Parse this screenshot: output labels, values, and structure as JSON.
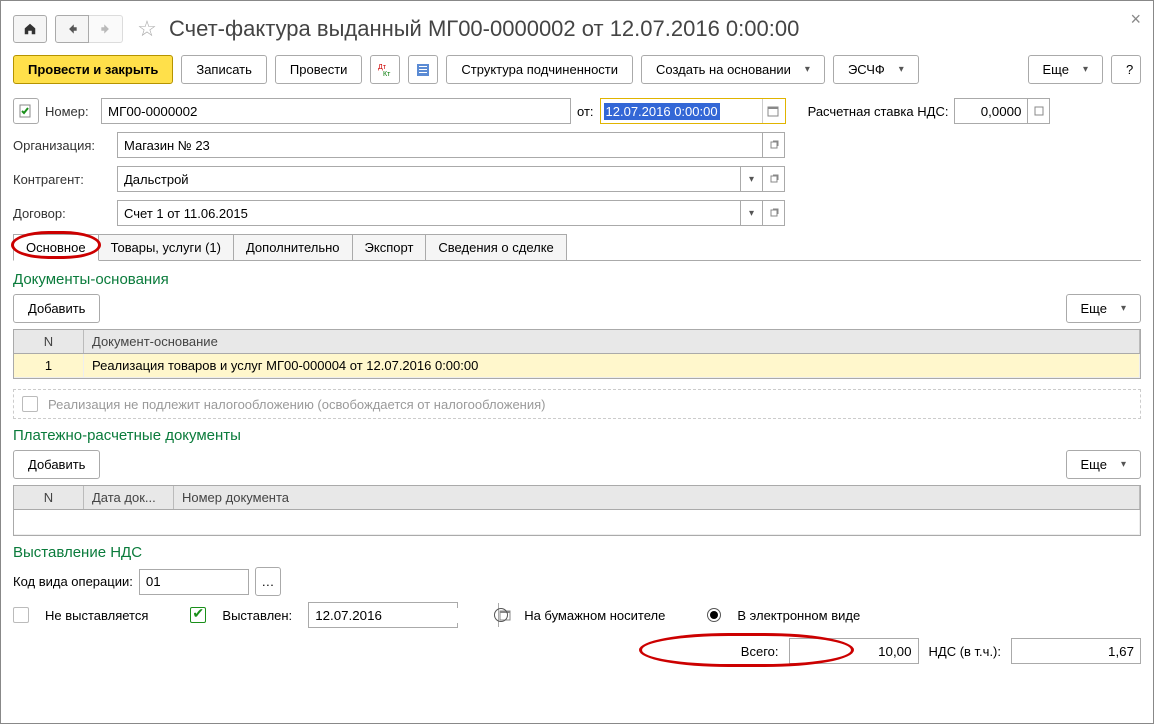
{
  "title": "Счет-фактура выданный МГ00-0000002 от 12.07.2016 0:00:00",
  "toolbar": {
    "post_close": "Провести и закрыть",
    "record": "Записать",
    "post": "Провести",
    "structure": "Структура подчиненности",
    "create_from": "Создать на основании",
    "eschf": "ЭСЧФ",
    "more": "Еще",
    "help": "?"
  },
  "form": {
    "number_label": "Номер:",
    "number_value": "МГ00-0000002",
    "date_label": "от:",
    "date_value": "12.07.2016 0:00:00",
    "rate_label": "Расчетная ставка НДС:",
    "rate_value": "0,0000",
    "org_label": "Организация:",
    "org_value": "Магазин № 23",
    "contr_label": "Контрагент:",
    "contr_value": "Дальстрой",
    "contract_label": "Договор:",
    "contract_value": "Счет 1 от 11.06.2015"
  },
  "tabs": {
    "main": "Основное",
    "goods": "Товары, услуги (1)",
    "extra": "Дополнительно",
    "export": "Экспорт",
    "deal": "Сведения о сделке"
  },
  "sections": {
    "docs_title": "Документы-основания",
    "payments_title": "Платежно-расчетные документы",
    "vat_title": "Выставление НДС"
  },
  "buttons": {
    "add": "Добавить",
    "more": "Еще"
  },
  "docs_table": {
    "h1": "N",
    "h2": "Документ-основание",
    "row_n": "1",
    "row_doc": "Реализация товаров и услуг МГ00-000004 от 12.07.2016 0:00:00"
  },
  "tax_free": "Реализация не подлежит налогообложению (освобождается от налогообложения)",
  "pay_table": {
    "h1": "N",
    "h2": "Дата док...",
    "h3": "Номер документа"
  },
  "vat": {
    "op_code_label": "Код вида операции:",
    "op_code": "01",
    "not_issued": "Не выставляется",
    "issued": "Выставлен:",
    "issued_date": "12.07.2016",
    "paper": "На бумажном носителе",
    "electronic": "В электронном виде"
  },
  "totals": {
    "total_label": "Всего:",
    "total_value": "10,00",
    "vat_label": "НДС (в т.ч.):",
    "vat_value": "1,67"
  }
}
